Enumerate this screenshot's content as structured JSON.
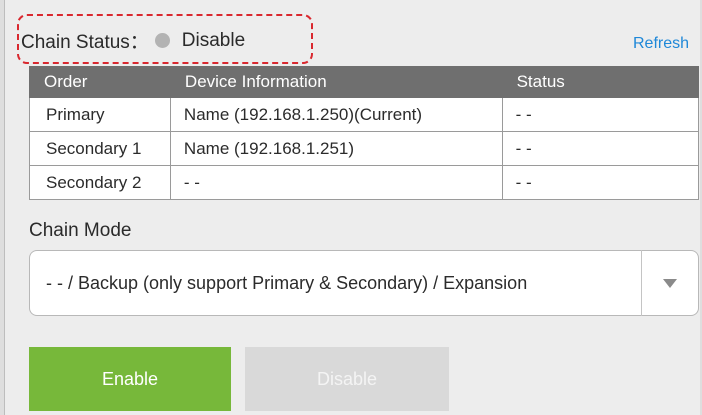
{
  "chain_status": {
    "label": "Chain Status：",
    "value": "Disable",
    "dot_color": "#b3b3b3",
    "highlight_color": "#d9282f"
  },
  "refresh_label": "Refresh",
  "table": {
    "headers": [
      "Order",
      "Device Information",
      "Status"
    ],
    "rows": [
      {
        "order": "Primary",
        "info": "Name (192.168.1.250)(Current)",
        "status": "- -"
      },
      {
        "order": "Secondary 1",
        "info": "Name (192.168.1.251)",
        "status": "- -"
      },
      {
        "order": "Secondary 2",
        "info": "- -",
        "status": "- -"
      }
    ]
  },
  "chain_mode": {
    "label": "Chain Mode",
    "selected": "- - / Backup (only support Primary & Secondary) / Expansion",
    "arrow_icon": "triangle-down-icon"
  },
  "buttons": {
    "enable": "Enable",
    "disable": "Disable",
    "enable_color": "#77b83a",
    "disable_color": "#d9d9d9"
  }
}
